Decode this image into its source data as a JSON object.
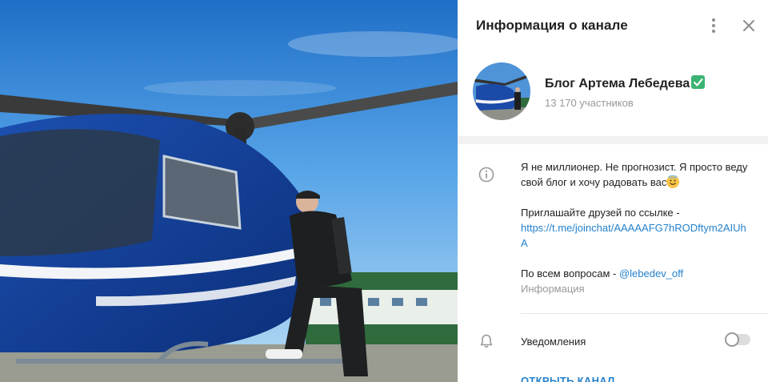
{
  "panel": {
    "title": "Информация о канале"
  },
  "channel": {
    "name": "Блог Артема Лебедева",
    "members": "13 170 участников"
  },
  "description": {
    "line1": "Я не миллионер. Не прогнозист. Я просто веду свой блог и хочу радовать вас",
    "invite_text": "Приглашайте друзей по ссылке -",
    "invite_link": "https://t.me/joinchat/AAAAAFG7hRODftym2AIUhA",
    "contact_text": "По всем вопросам -",
    "contact_link": "@lebedev_off",
    "caption": "Информация"
  },
  "notifications": {
    "label": "Уведомления",
    "enabled": false
  },
  "actions": {
    "open_channel": "ОТКРЫТЬ КАНАЛ"
  },
  "icons": {
    "menu": "more-vertical-icon",
    "close": "close-icon",
    "info": "info-icon",
    "bell": "bell-icon",
    "verified": "verified-check-icon"
  },
  "colors": {
    "accent": "#2481cc",
    "verified": "#3cb371"
  }
}
